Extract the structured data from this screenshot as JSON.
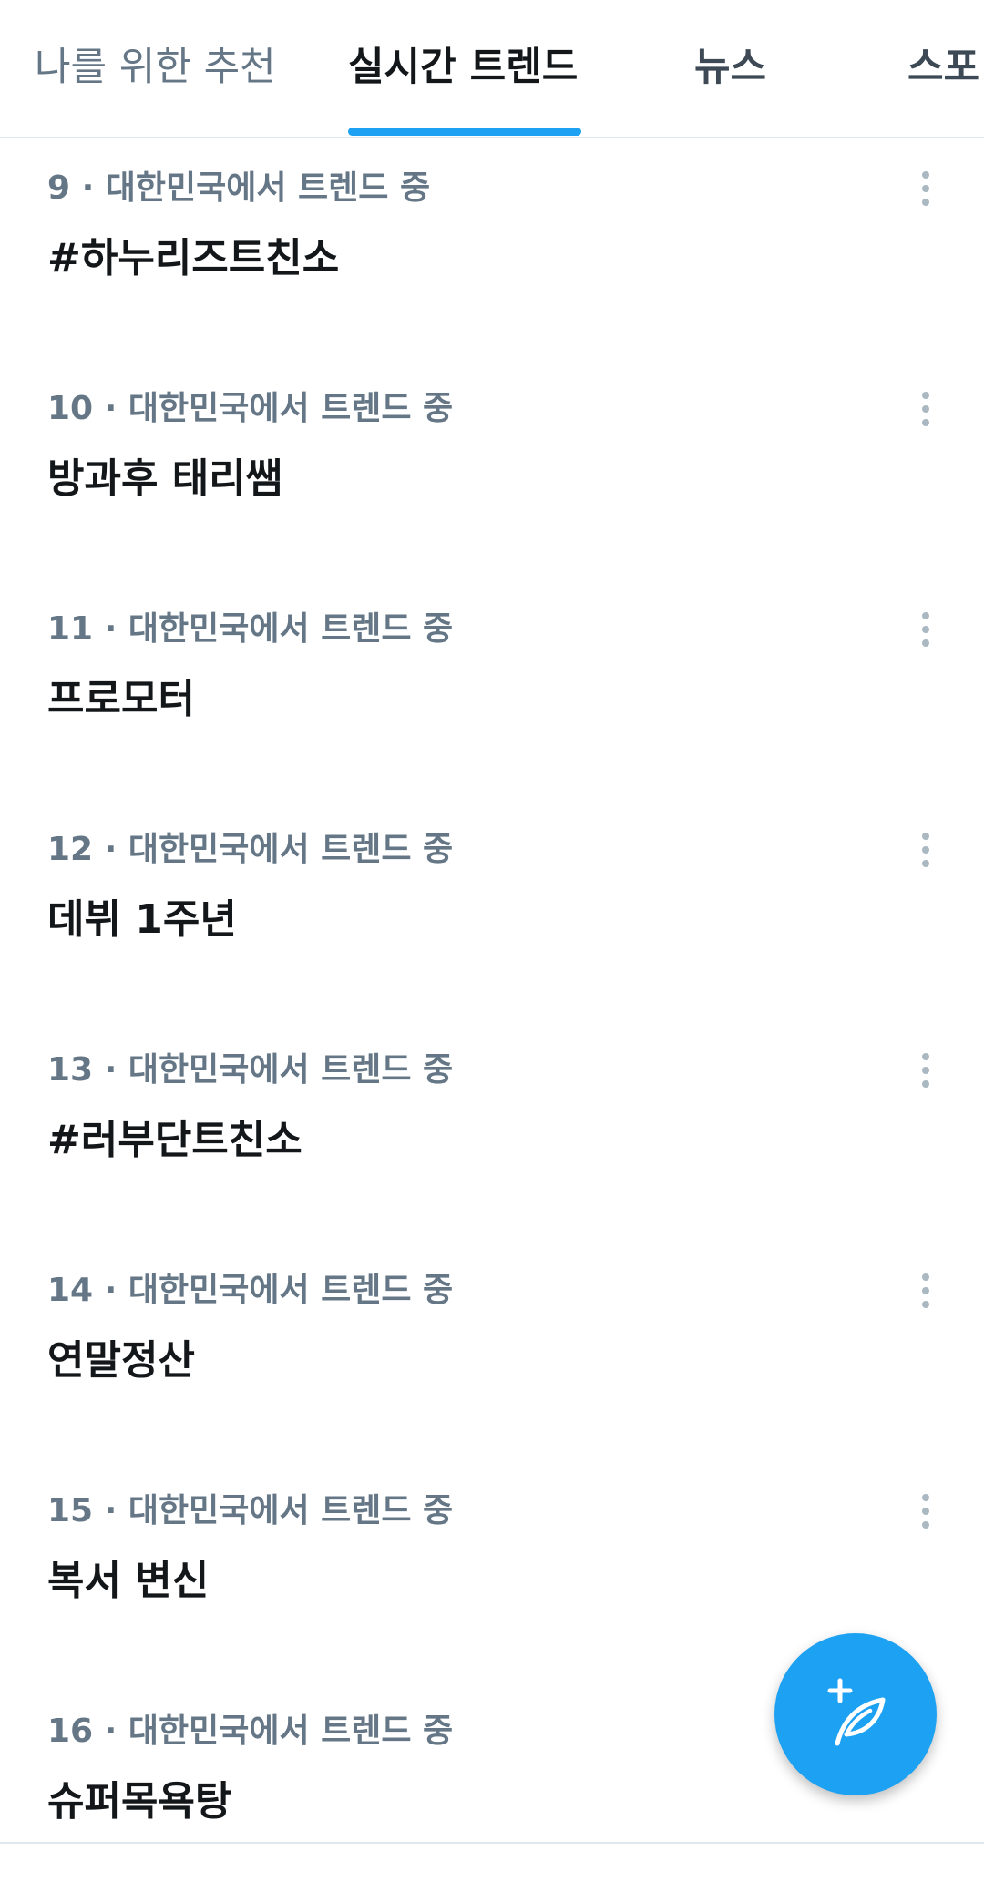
{
  "tabs": [
    {
      "label": "나를 위한 추천",
      "active": false
    },
    {
      "label": "실시간 트렌드",
      "active": true
    },
    {
      "label": "뉴스",
      "active": false
    },
    {
      "label": "스포",
      "active": false
    }
  ],
  "trends": [
    {
      "meta": "9 · 대한민국에서 트렌드 중",
      "name": "#하누리즈트친소"
    },
    {
      "meta": "10 · 대한민국에서 트렌드 중",
      "name": "방과후 태리쌤"
    },
    {
      "meta": "11 · 대한민국에서 트렌드 중",
      "name": "프로모터"
    },
    {
      "meta": "12 · 대한민국에서 트렌드 중",
      "name": "데뷔 1주년"
    },
    {
      "meta": "13 · 대한민국에서 트렌드 중",
      "name": "#러부단트친소"
    },
    {
      "meta": "14 · 대한민국에서 트렌드 중",
      "name": "연말정산"
    },
    {
      "meta": "15 · 대한민국에서 트렌드 중",
      "name": "복서 변신"
    },
    {
      "meta": "16 · 대한민국에서 트렌드 중",
      "name": "슈퍼목욕탕"
    }
  ],
  "icons": {
    "more": "more-vertical-icon",
    "compose": "compose-tweet-icon"
  },
  "colors": {
    "accent": "#1da1f2",
    "meta_text": "#657786",
    "primary_text": "#14171a",
    "dots": "#aab8c2"
  }
}
